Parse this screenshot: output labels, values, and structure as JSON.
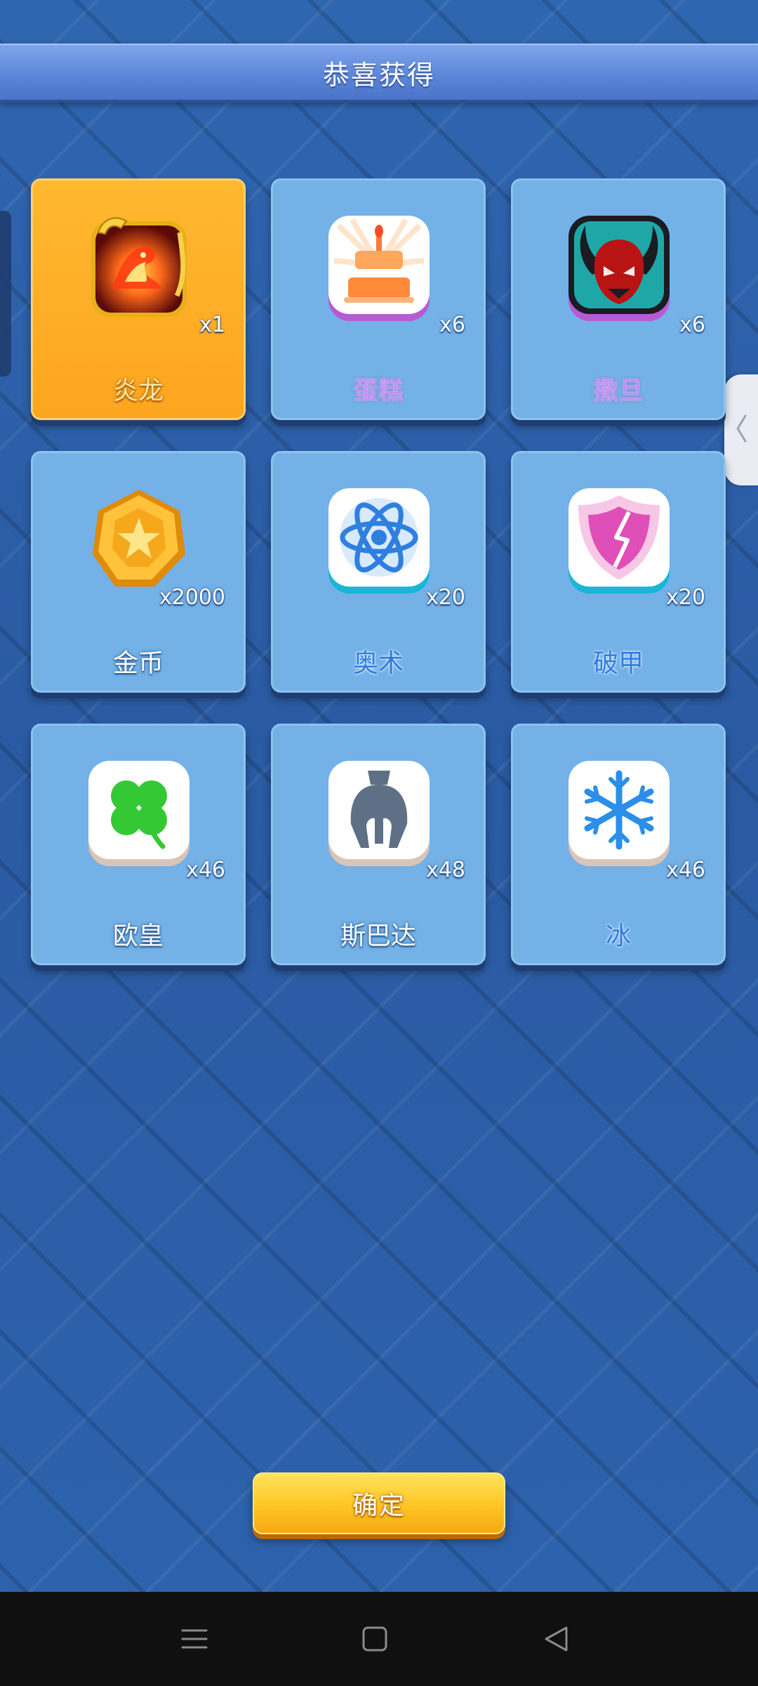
{
  "header": {
    "title": "恭喜获得"
  },
  "rewards": [
    {
      "name": "炎龙",
      "count": "x1",
      "icon": "fire-dragon-icon",
      "featured": true,
      "name_tone": "gold"
    },
    {
      "name": "蛋糕",
      "count": "x6",
      "icon": "cake-icon",
      "featured": false,
      "name_tone": "purple"
    },
    {
      "name": "撒旦",
      "count": "x6",
      "icon": "demon-mask-icon",
      "featured": false,
      "name_tone": "purple"
    },
    {
      "name": "金币",
      "count": "x2000",
      "icon": "gold-coin-icon",
      "featured": false,
      "name_tone": "white"
    },
    {
      "name": "奥术",
      "count": "x20",
      "icon": "atom-icon",
      "featured": false,
      "name_tone": "blue"
    },
    {
      "name": "破甲",
      "count": "x20",
      "icon": "broken-shield-icon",
      "featured": false,
      "name_tone": "blue"
    },
    {
      "name": "欧皇",
      "count": "x46",
      "icon": "four-leaf-clover-icon",
      "featured": false,
      "name_tone": "white"
    },
    {
      "name": "斯巴达",
      "count": "x48",
      "icon": "spartan-helmet-icon",
      "featured": false,
      "name_tone": "white"
    },
    {
      "name": "冰",
      "count": "x46",
      "icon": "snowflake-icon",
      "featured": false,
      "name_tone": "blue"
    }
  ],
  "confirm": {
    "label": "确定"
  },
  "nav_bar": {
    "buttons": [
      "menu-icon",
      "home-square-icon",
      "back-triangle-icon"
    ]
  },
  "colors": {
    "card_blue": "#73b1e6",
    "card_featured": "#fda51f",
    "button_yellow": "#ffc524",
    "banner_blue": "#5c86d8"
  }
}
